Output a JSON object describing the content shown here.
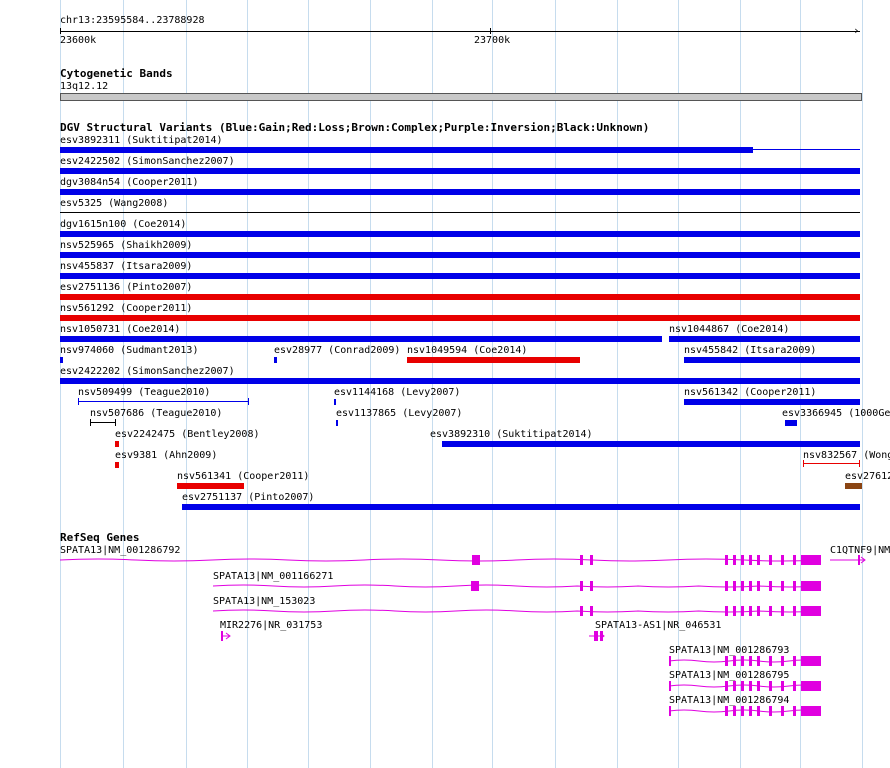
{
  "colors": {
    "gain": "#0000e8",
    "loss": "#e80000",
    "complex": "#8b4513",
    "gene": "#e000e0",
    "grid": "#c6dcee",
    "band": "#c8c8c8"
  },
  "ruler": {
    "coords": "chr13:23595584..23788928",
    "tick_left": "23600k",
    "tick_mid": "23700k"
  },
  "cytoband": {
    "title": "Cytogenetic Bands",
    "band": "13q12.12"
  },
  "dgv": {
    "title": "DGV Structural Variants (Blue:Gain;Red:Loss;Brown:Complex;Purple:Inversion;Black:Unknown)",
    "items": [
      {
        "label": "esv3892311 (Suktitipat2014)",
        "type": "gain"
      },
      {
        "label": "esv2422502 (SimonSanchez2007)",
        "type": "gain"
      },
      {
        "label": "dgv3084n54 (Cooper2011)",
        "type": "gain"
      },
      {
        "label": "esv5325 (Wang2008)",
        "type": "unknown"
      },
      {
        "label": "dgv1615n100 (Coe2014)",
        "type": "gain"
      },
      {
        "label": "nsv525965 (Shaikh2009)",
        "type": "gain"
      },
      {
        "label": "nsv455837 (Itsara2009)",
        "type": "gain"
      },
      {
        "label": "esv2751136 (Pinto2007)",
        "type": "loss"
      },
      {
        "label": "nsv561292 (Cooper2011)",
        "type": "loss"
      },
      {
        "label": "nsv1050731 (Coe2014)",
        "type": "gain"
      },
      {
        "label": "nsv1044867 (Coe2014)",
        "type": "gain"
      },
      {
        "label": "nsv974060 (Sudmant2013)",
        "type": "gain"
      },
      {
        "label": "esv28977 (Conrad2009)",
        "type": "gain"
      },
      {
        "label": "nsv1049594 (Coe2014)",
        "type": "loss"
      },
      {
        "label": "nsv455842 (Itsara2009)",
        "type": "gain"
      },
      {
        "label": "esv2422202 (SimonSanchez2007)",
        "type": "gain"
      },
      {
        "label": "nsv509499 (Teague2010)",
        "type": "gain"
      },
      {
        "label": "esv1144168 (Levy2007)",
        "type": "gain"
      },
      {
        "label": "nsv561342 (Cooper2011)",
        "type": "gain"
      },
      {
        "label": "nsv507686 (Teague2010)",
        "type": "unknown"
      },
      {
        "label": "esv1137865 (Levy2007)",
        "type": "gain"
      },
      {
        "label": "esv3366945 (1000Ge",
        "type": "gain"
      },
      {
        "label": "esv2242475 (Bentley2008)",
        "type": "loss"
      },
      {
        "label": "esv3892310 (Suktitipat2014)",
        "type": "gain"
      },
      {
        "label": "esv9381 (Ahn2009)",
        "type": "loss"
      },
      {
        "label": "nsv832567 (Wong",
        "type": "loss"
      },
      {
        "label": "nsv561341 (Cooper2011)",
        "type": "loss"
      },
      {
        "label": "esv27612",
        "type": "complex"
      },
      {
        "label": "esv2751137 (Pinto2007)",
        "type": "gain"
      }
    ]
  },
  "refseq": {
    "title": "RefSeq Genes",
    "genes": [
      {
        "label": "SPATA13|NM_001286792"
      },
      {
        "label": "C1QTNF9|NM"
      },
      {
        "label": "SPATA13|NM_001166271"
      },
      {
        "label": "SPATA13|NM_153023"
      },
      {
        "label": "MIR2276|NR_031753"
      },
      {
        "label": "SPATA13-AS1|NR_046531"
      },
      {
        "label": "SPATA13|NM_001286793"
      },
      {
        "label": "SPATA13|NM_001286795"
      },
      {
        "label": "SPATA13|NM_001286794"
      }
    ]
  }
}
